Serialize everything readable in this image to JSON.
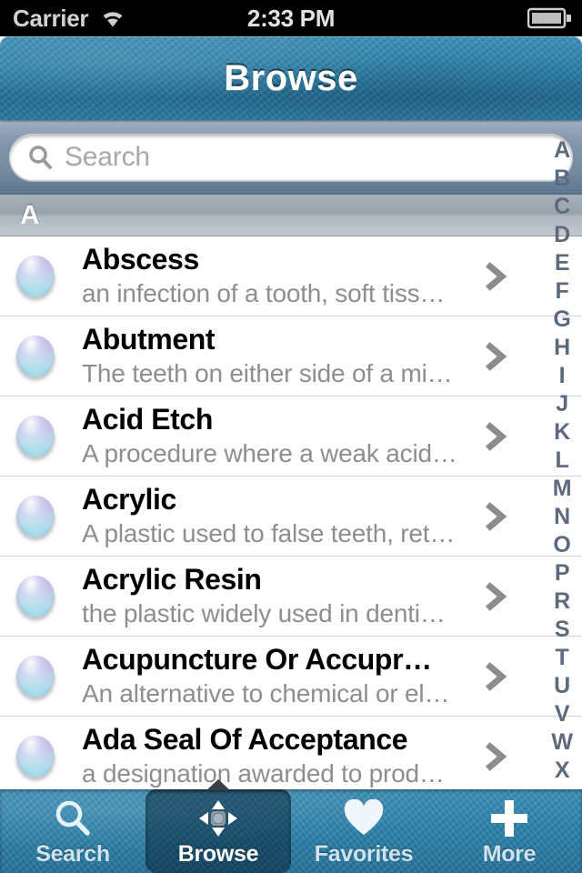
{
  "status_bar": {
    "carrier": "Carrier",
    "time": "2:33 PM",
    "wifi_icon": "wifi-icon",
    "battery_icon": "battery-full-icon"
  },
  "nav_bar": {
    "title": "Browse"
  },
  "search": {
    "placeholder": "Search",
    "value": "",
    "icon": "search-magnifier-icon"
  },
  "section": {
    "header": "A"
  },
  "index_strip": {
    "letters": [
      "A",
      "B",
      "C",
      "D",
      "E",
      "F",
      "G",
      "H",
      "I",
      "J",
      "K",
      "L",
      "M",
      "N",
      "O",
      "P",
      "R",
      "S",
      "T",
      "U",
      "V",
      "W",
      "X"
    ]
  },
  "list": {
    "rows": [
      {
        "title": "Abscess",
        "subtitle": "an infection of a tooth, soft tiss…"
      },
      {
        "title": "Abutment",
        "subtitle": "The teeth on either side of a mi…"
      },
      {
        "title": "Acid Etch",
        "subtitle": "A procedure where a weak acid…"
      },
      {
        "title": "Acrylic",
        "subtitle": "A plastic used to false teeth, ret…"
      },
      {
        "title": "Acrylic Resin",
        "subtitle": "the plastic widely used in denti…"
      },
      {
        "title": "Acupuncture Or Accupr…",
        "subtitle": "An alternative to chemical or el…"
      },
      {
        "title": "Ada Seal Of Acceptance",
        "subtitle": "a designation awarded to prod…"
      }
    ]
  },
  "tab_bar": {
    "tabs": [
      {
        "label": "Search",
        "icon": "search-magnifier-icon",
        "selected": false
      },
      {
        "label": "Browse",
        "icon": "dpad-navigation-icon",
        "selected": true
      },
      {
        "label": "Favorites",
        "icon": "heart-icon",
        "selected": false
      },
      {
        "label": "More",
        "icon": "plus-icon",
        "selected": false
      }
    ]
  },
  "colors": {
    "nav_blue": "#2b81ab",
    "tab_blue": "#2d84ae",
    "search_bar_gray": "#8496ad",
    "index_letter": "#5d6a7d",
    "subtitle_gray": "#8e8e8e"
  }
}
